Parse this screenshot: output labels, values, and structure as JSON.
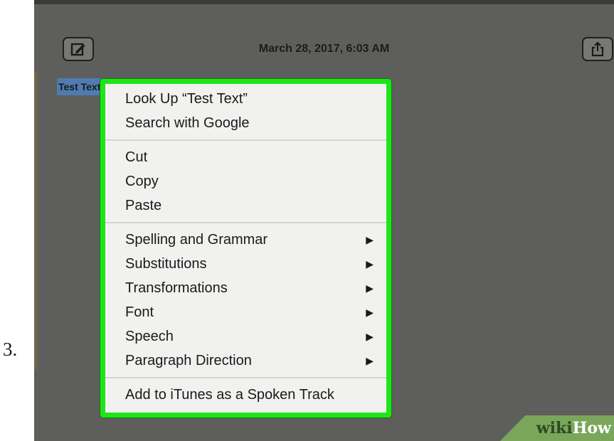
{
  "step_number": "3.",
  "note": {
    "date": "March 28, 2017, 6:03 AM",
    "selected_text": "Test Text"
  },
  "toolbar": {
    "compose_icon": "compose-icon",
    "share_icon": "share-icon"
  },
  "context_menu": {
    "highlight_color": "#1fe41a",
    "section_lookup": [
      {
        "label": "Look Up “Test Text”"
      },
      {
        "label": "Search with Google"
      }
    ],
    "section_edit": [
      {
        "label": "Cut"
      },
      {
        "label": "Copy"
      },
      {
        "label": "Paste"
      }
    ],
    "section_submenus": [
      {
        "label": "Spelling and Grammar",
        "arrow": "▶"
      },
      {
        "label": "Substitutions",
        "arrow": "▶"
      },
      {
        "label": "Transformations",
        "arrow": "▶"
      },
      {
        "label": "Font",
        "arrow": "▶"
      },
      {
        "label": "Speech",
        "arrow": "▶"
      },
      {
        "label": "Paragraph Direction",
        "arrow": "▶"
      }
    ],
    "section_itunes": [
      {
        "label": "Add to iTunes as a Spoken Track"
      }
    ]
  },
  "watermark": {
    "wiki": "wiki",
    "how": "How"
  }
}
